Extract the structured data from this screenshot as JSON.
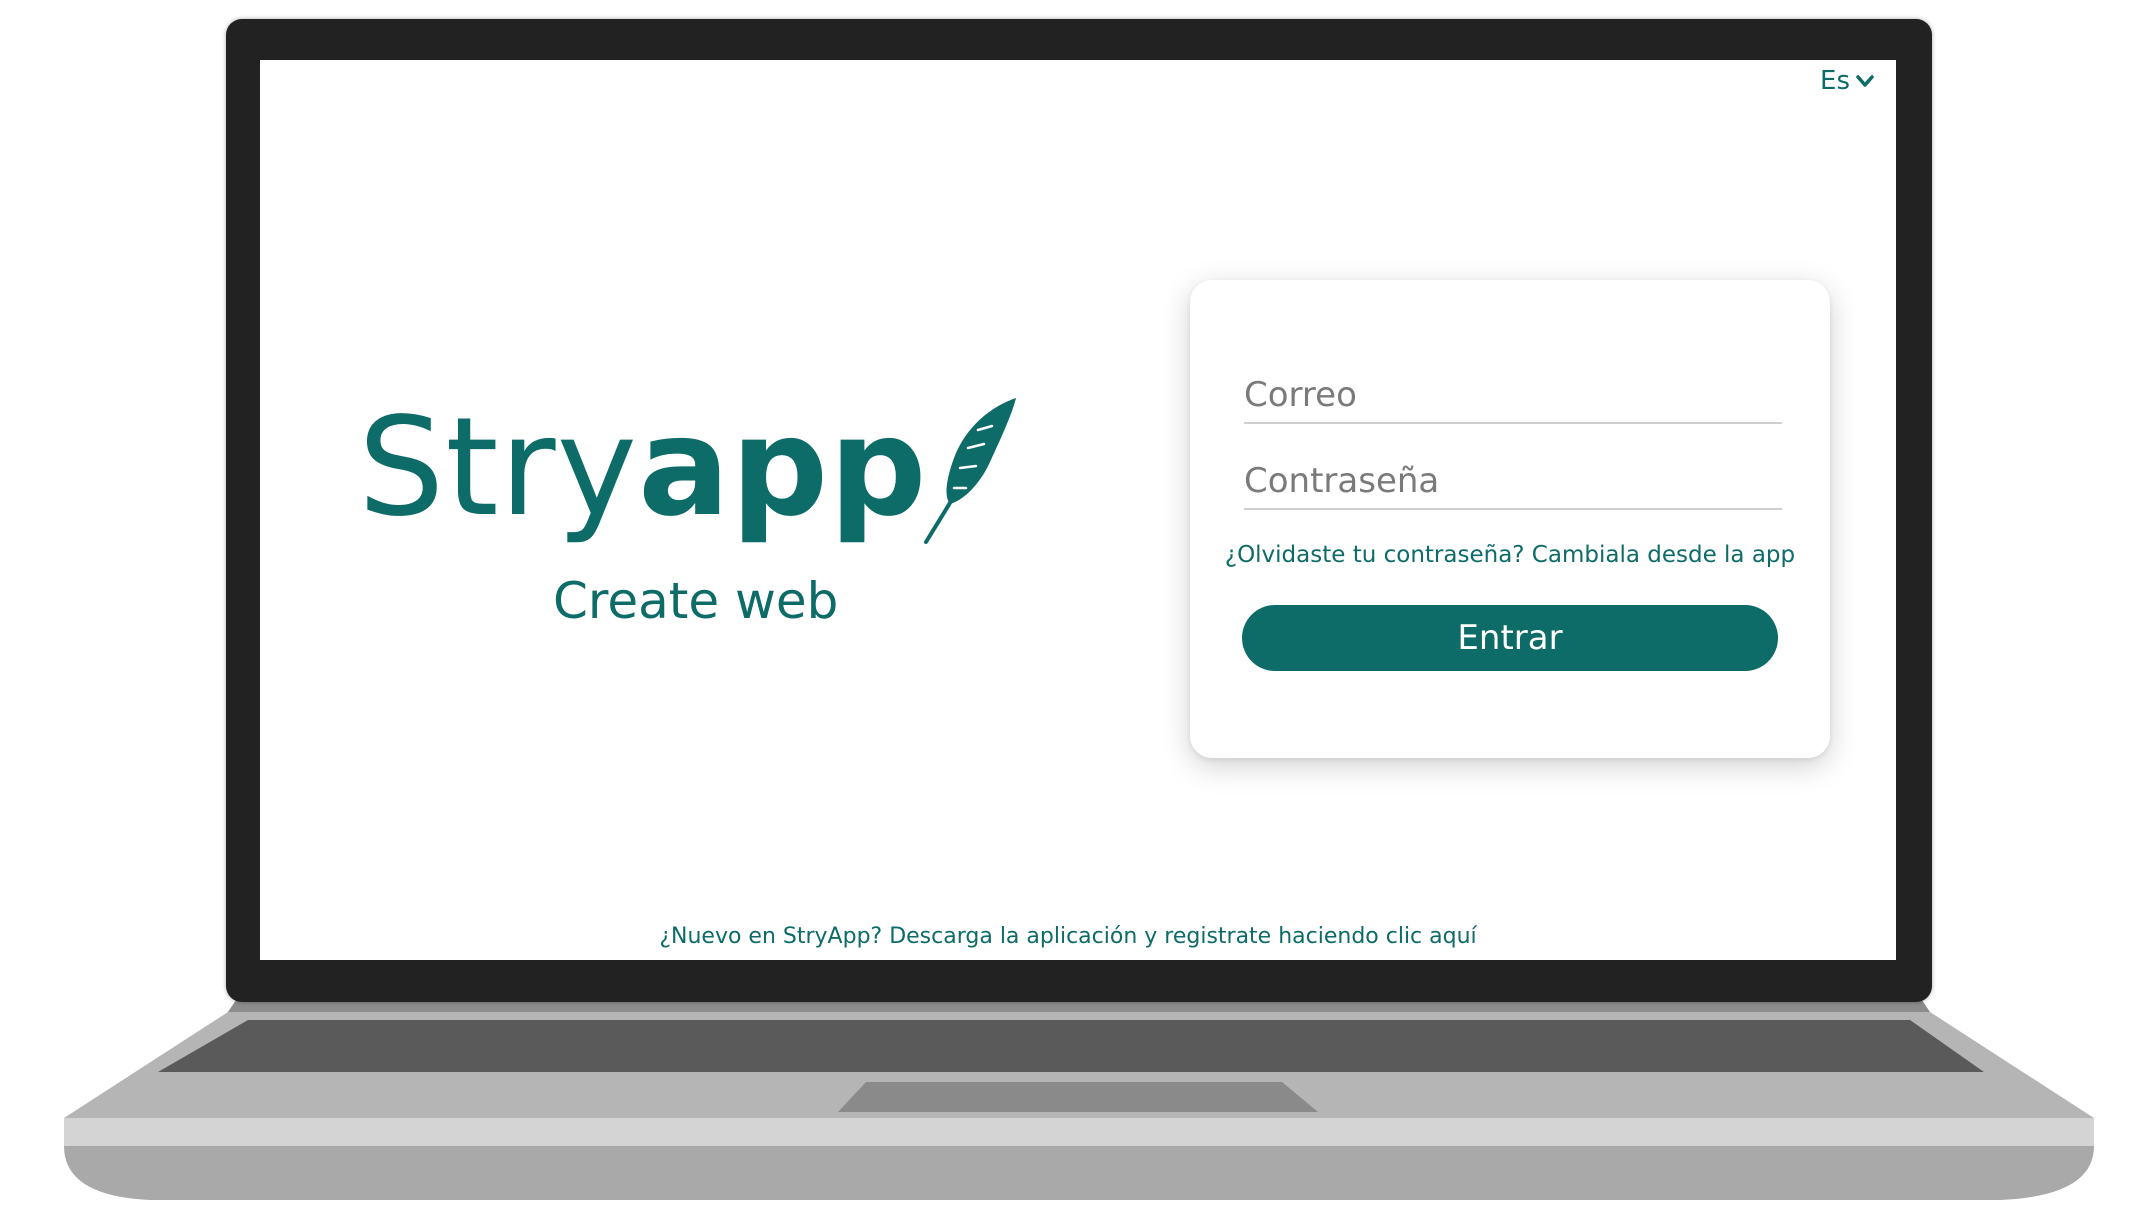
{
  "header": {
    "language_label": "Es",
    "language_icon": "chevron-down-icon"
  },
  "brand": {
    "name_light": "Stry",
    "name_bold": "app",
    "logo_icon": "feather-icon",
    "subtitle": "Create web"
  },
  "login": {
    "email_placeholder": "Correo",
    "password_placeholder": "Contraseña",
    "forgot_link": "¿Olvidaste tu contraseña? Cambiala desde la app",
    "submit_label": "Entrar"
  },
  "footer": {
    "signup_link": "¿Nuevo en StryApp? Descarga la aplicación y registrate haciendo clic aquí"
  },
  "colors": {
    "brand": "#0d6b68",
    "bezel": "#222222",
    "keyboard_deck": "#5a5a5a",
    "chassis": "#b3b3b3"
  }
}
